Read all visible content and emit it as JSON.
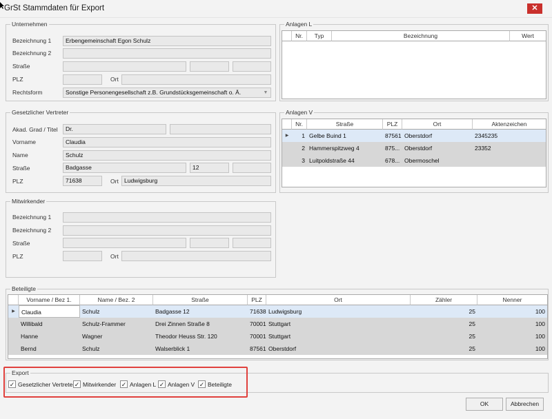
{
  "window": {
    "title": "GrSt Stammdaten für Export",
    "close_glyph": "✕"
  },
  "unternehmen": {
    "legend": "Unternehmen",
    "bezeichnung1_label": "Bezeichnung 1",
    "bezeichnung1_value": "Erbengemeinschaft Egon Schulz",
    "bezeichnung2_label": "Bezeichnung 2",
    "bezeichnung2_value": "",
    "strasse_label": "Straße",
    "plz_label": "PLZ",
    "ort_label": "Ort",
    "rechtsform_label": "Rechtsform",
    "rechtsform_value": "Sonstige Personengesellschaft z.B. Grundstücksgemeinschaft o. Ä."
  },
  "vertreter": {
    "legend": "Gesetzlicher Vertreter",
    "titel_label": "Akad. Grad / Titel",
    "titel_value": "Dr.",
    "vorname_label": "Vorname",
    "vorname_value": "Claudia",
    "name_label": "Name",
    "name_value": "Schulz",
    "strasse_label": "Straße",
    "strasse_value": "Badgasse",
    "hausnr_value": "12",
    "plz_label": "PLZ",
    "plz_value": "71638",
    "ort_label": "Ort",
    "ort_value": "Ludwigsburg"
  },
  "mitwirkender": {
    "legend": "Mitwirkender",
    "bezeichnung1_label": "Bezeichnung 1",
    "bezeichnung2_label": "Bezeichnung 2",
    "strasse_label": "Straße",
    "plz_label": "PLZ",
    "ort_label": "Ort"
  },
  "anlagen_l": {
    "legend": "Anlagen L",
    "headers": [
      "Nr.",
      "Typ",
      "Bezeichnung",
      "Wert"
    ]
  },
  "anlagen_v": {
    "legend": "Anlagen V",
    "headers": [
      "Nr.",
      "Straße",
      "PLZ",
      "Ort",
      "Aktenzeichen"
    ],
    "rows": [
      {
        "nr": "1",
        "strasse": "Gelbe Buind 1",
        "plz": "87561",
        "ort": "Oberstdorf",
        "az": "2345235"
      },
      {
        "nr": "2",
        "strasse": "Hammerspitzweg 4",
        "plz": "875...",
        "ort": "Oberstdorf",
        "az": "23352"
      },
      {
        "nr": "3",
        "strasse": "Luitpoldstraße 44",
        "plz": "678...",
        "ort": "Obermoschel",
        "az": ""
      }
    ]
  },
  "beteiligte": {
    "legend": "Beteiligte",
    "headers": [
      "Vorname / Bez 1.",
      "Name / Bez. 2",
      "Straße",
      "PLZ",
      "Ort",
      "Zähler",
      "Nenner"
    ],
    "rows": [
      {
        "vorname": "Claudia",
        "name": "Schulz",
        "strasse": "Badgasse 12",
        "plz": "71638",
        "ort": "Ludwigsburg",
        "zaehler": "25",
        "nenner": "100"
      },
      {
        "vorname": "Willibald",
        "name": "Schulz-Frammer",
        "strasse": "Drei Zinnen Straße 8",
        "plz": "70001",
        "ort": "Stuttgart",
        "zaehler": "25",
        "nenner": "100"
      },
      {
        "vorname": "Hanne",
        "name": "Wagner",
        "strasse": "Theodor Heuss Str. 120",
        "plz": "70001",
        "ort": "Stuttgart",
        "zaehler": "25",
        "nenner": "100"
      },
      {
        "vorname": "Bernd",
        "name": "Schulz",
        "strasse": "Walserblick 1",
        "plz": "87561",
        "ort": "Oberstdorf",
        "zaehler": "25",
        "nenner": "100"
      }
    ]
  },
  "export": {
    "legend": "Export",
    "items": [
      {
        "label": "Gesetzlicher Vertreter",
        "checked": true
      },
      {
        "label": "Mitwirkender",
        "checked": true
      },
      {
        "label": "Anlagen L",
        "checked": true
      },
      {
        "label": "Anlagen V",
        "checked": true
      },
      {
        "label": "Beteiligte",
        "checked": true
      }
    ],
    "check_glyph": "✓"
  },
  "buttons": {
    "ok": "OK",
    "cancel": "Abbrechen"
  },
  "colors": {
    "selected_row": "#dde9f7",
    "gray_row": "#d7d7d7",
    "highlight": "#e0403c",
    "close": "#c9302c"
  }
}
